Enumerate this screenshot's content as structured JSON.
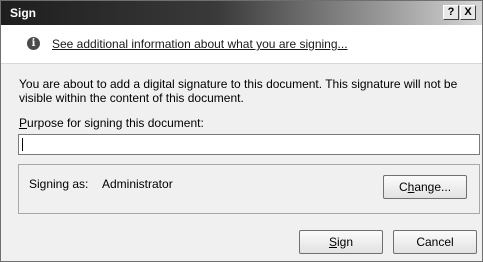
{
  "window": {
    "title": "Sign",
    "help_glyph": "?",
    "close_glyph": "X"
  },
  "info": {
    "icon": "info-icon",
    "link_text": "See additional information about what you are signing..."
  },
  "description": "You are about to add a digital signature to this document. This signature will not be visible within the content of this document.",
  "purpose": {
    "label_first": "P",
    "label_rest": "urpose for signing this document:",
    "value": ""
  },
  "signing": {
    "label": "Signing as:",
    "name": "Administrator",
    "change_pre": "C",
    "change_ul": "h",
    "change_post": "ange..."
  },
  "buttons": {
    "sign_ul": "S",
    "sign_rest": "ign",
    "cancel": "Cancel"
  }
}
